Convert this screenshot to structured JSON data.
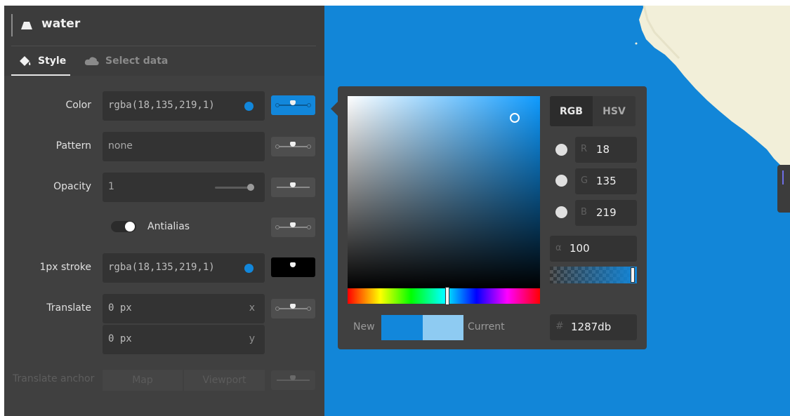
{
  "layer": {
    "title": "water",
    "icon": "water-layer-icon"
  },
  "tabs": {
    "style": "Style",
    "select_data": "Select data"
  },
  "properties": {
    "color": {
      "label": "Color",
      "value": "rgba(18,135,219,1)"
    },
    "pattern": {
      "label": "Pattern",
      "placeholder": "none"
    },
    "opacity": {
      "label": "Opacity",
      "value": "1"
    },
    "antialias": {
      "label": "Antialias",
      "enabled": true
    },
    "stroke": {
      "label": "1px stroke",
      "value": "rgba(18,135,219,1)"
    },
    "translate": {
      "label": "Translate",
      "x_value": "0 px",
      "x_axis": "x",
      "y_value": "0 px",
      "y_axis": "y"
    },
    "translate_anchor": {
      "label": "Translate anchor",
      "options": [
        "Map",
        "Viewport"
      ]
    }
  },
  "picker": {
    "modes": [
      "RGB",
      "HSV"
    ],
    "active_mode": "RGB",
    "channels": [
      {
        "key": "R",
        "value": "18"
      },
      {
        "key": "G",
        "value": "135"
      },
      {
        "key": "B",
        "value": "219"
      }
    ],
    "alpha": {
      "key": "α",
      "value": "100"
    },
    "new_label": "New",
    "current_label": "Current",
    "hex": {
      "key": "#",
      "value": "1287db"
    }
  },
  "colors": {
    "water": "#1286d8",
    "selected": "#1287db",
    "current": "#8ecbf2",
    "land": "#f2efd9"
  }
}
